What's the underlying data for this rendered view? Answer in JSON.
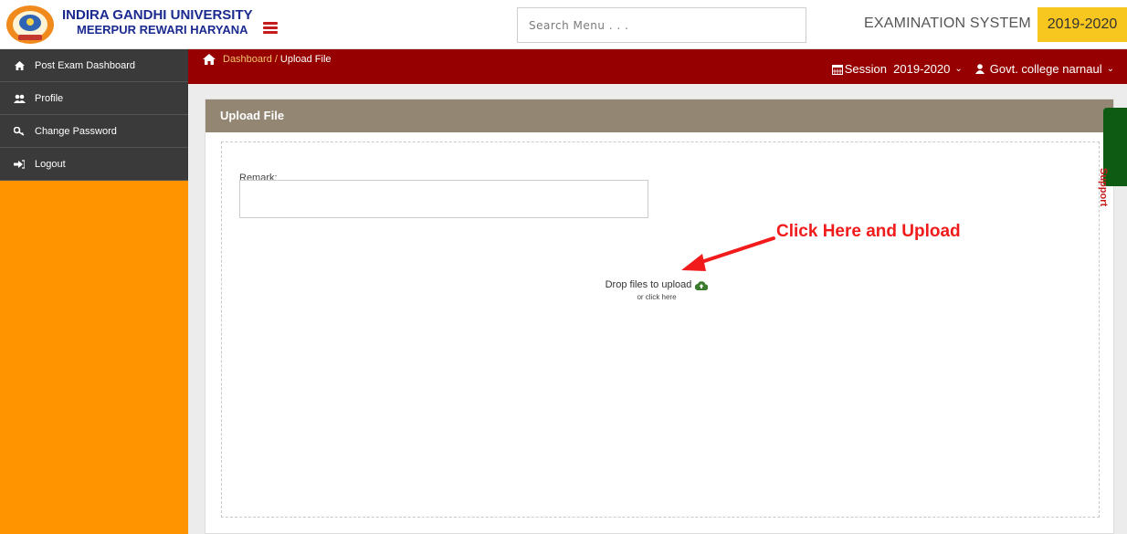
{
  "header": {
    "university_line1": "INDIRA GANDHI UNIVERSITY",
    "university_line2": "MEERPUR REWARI HARYANA",
    "search_placeholder": "Search Menu . . .",
    "system_title": "EXAMINATION SYSTEM",
    "year_badge": "2019-2020"
  },
  "sidebar": {
    "items": [
      {
        "label": "Post Exam Dashboard",
        "icon": "home-icon"
      },
      {
        "label": "Profile",
        "icon": "users-icon"
      },
      {
        "label": "Change Password",
        "icon": "key-icon"
      },
      {
        "label": "Logout",
        "icon": "sign-out-icon"
      }
    ]
  },
  "breadcrumb": {
    "home_link": "Dashboard",
    "separator": "/",
    "current": "Upload File"
  },
  "topbar_right": {
    "session_label": "Session  2019-2020",
    "user_label": "Govt. college narnaul"
  },
  "panel": {
    "title": "Upload File",
    "remark_label": "Remark:",
    "drop_text": "Drop files to upload",
    "drop_subtext": "or click here"
  },
  "annotation": {
    "text": "Click Here and Upload"
  },
  "support_tab": {
    "label": "Support"
  },
  "colors": {
    "sidebar_bg": "#ff9300",
    "sidebar_item_bg": "#3a3a3a",
    "crumbbar_bg": "#960000",
    "panel_header_bg": "#938673",
    "year_badge_bg": "#f7c61f",
    "annotation_color": "#f21b1b",
    "support_bg": "#0e5c14"
  }
}
